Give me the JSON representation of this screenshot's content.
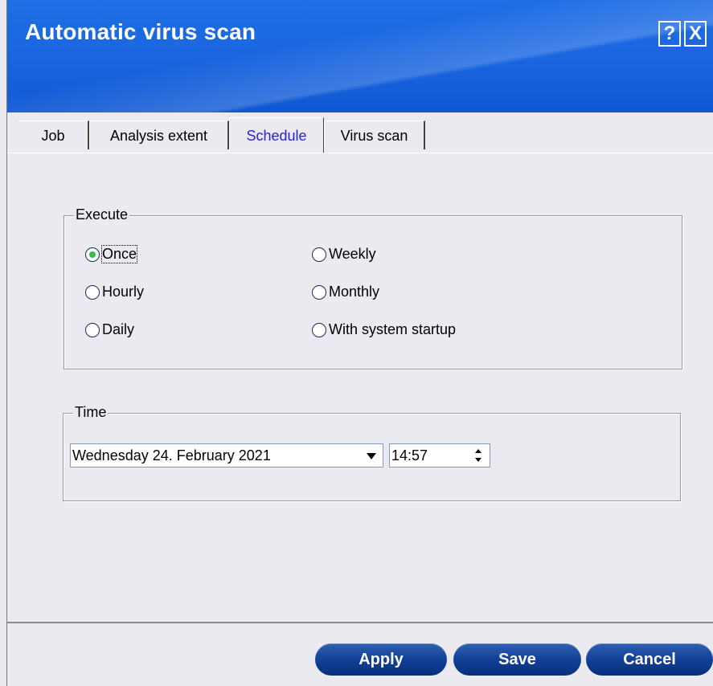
{
  "window": {
    "title": "Automatic virus scan",
    "help_label": "?",
    "close_label": "X"
  },
  "tabs": [
    {
      "label": "Job"
    },
    {
      "label": "Analysis extent"
    },
    {
      "label": "Schedule"
    },
    {
      "label": "Virus scan"
    }
  ],
  "active_tab": "Schedule",
  "execute": {
    "title": "Execute",
    "options": [
      {
        "label": "Once",
        "selected": true
      },
      {
        "label": "Hourly",
        "selected": false
      },
      {
        "label": "Daily",
        "selected": false
      },
      {
        "label": "Weekly",
        "selected": false
      },
      {
        "label": "Monthly",
        "selected": false
      },
      {
        "label": "With system startup",
        "selected": false
      }
    ]
  },
  "time": {
    "title": "Time",
    "date_value": "Wednesday 24. February 2021",
    "time_value": "14:57"
  },
  "buttons": {
    "apply": "Apply",
    "save": "Save",
    "cancel": "Cancel"
  },
  "colors": {
    "header_blue": "#1a66e0",
    "button_blue": "#0f3f95",
    "active_tab_text": "#2222dd",
    "radio_selected": "#31c04a"
  }
}
